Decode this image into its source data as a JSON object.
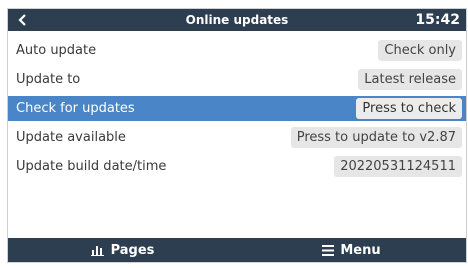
{
  "header": {
    "title": "Online updates",
    "time": "15:42",
    "back_icon": "chevron-left-icon"
  },
  "rows": [
    {
      "label": "Auto update",
      "value": "Check only",
      "selected": false
    },
    {
      "label": "Update to",
      "value": "Latest release",
      "selected": false
    },
    {
      "label": "Check for updates",
      "value": "Press to check",
      "selected": true
    },
    {
      "label": "Update available",
      "value": "Press to update to v2.87",
      "selected": false
    },
    {
      "label": "Update build date/time",
      "value": "20220531124511",
      "selected": false
    }
  ],
  "footer": {
    "pages_label": "Pages",
    "pages_icon": "bar-chart-icon",
    "menu_label": "Menu",
    "menu_icon": "hamburger-menu-icon"
  },
  "colors": {
    "bar_background": "#2c3e50",
    "selection": "#4a86c7",
    "value_box": "#e6e6e6"
  }
}
